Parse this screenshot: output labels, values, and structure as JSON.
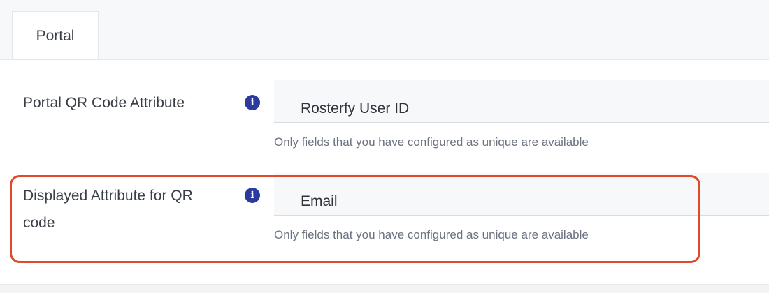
{
  "tabs": [
    {
      "label": "Portal"
    }
  ],
  "fields": [
    {
      "label": "Portal QR Code Attribute",
      "info_icon": "info-icon",
      "value": "Rosterfy User ID",
      "hint": "Only fields that you have configured as unique are available"
    },
    {
      "label_line1": "Displayed Attribute for QR",
      "label_line2": "code",
      "info_icon": "info-icon",
      "value": "Email",
      "hint": "Only fields that you have configured as unique are available"
    }
  ],
  "colors": {
    "info_icon": "#2b3a9e",
    "highlight_border": "#e04a2a"
  }
}
